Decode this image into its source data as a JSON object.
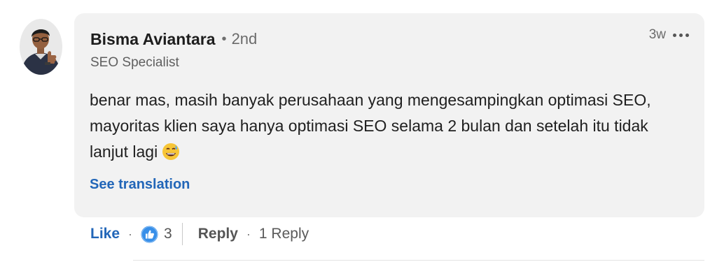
{
  "comment": {
    "author": {
      "name": "Bisma Aviantara",
      "separator": "•",
      "degree": "2nd",
      "headline": "SEO Specialist",
      "avatar_icon": "profile-photo"
    },
    "timestamp": "3w",
    "more_icon": "ellipsis-icon",
    "text": "benar mas, masih banyak perusahaan yang mengesampingkan optimasi SEO, mayoritas klien saya hanya optimasi SEO selama 2 bulan dan setelah itu tidak lanjut lagi",
    "emoji": "grinning-face-with-sweat",
    "see_translation": "See translation"
  },
  "actions": {
    "like_label": "Like",
    "dot": "·",
    "reaction_icon": "thumbs-up-reaction-icon",
    "reaction_count": "3",
    "reply_label": "Reply",
    "reply_count": "1 Reply"
  },
  "colors": {
    "link_blue": "#2266b8",
    "bubble_bg": "#f2f2f2",
    "reaction_blue": "#378fe9"
  }
}
